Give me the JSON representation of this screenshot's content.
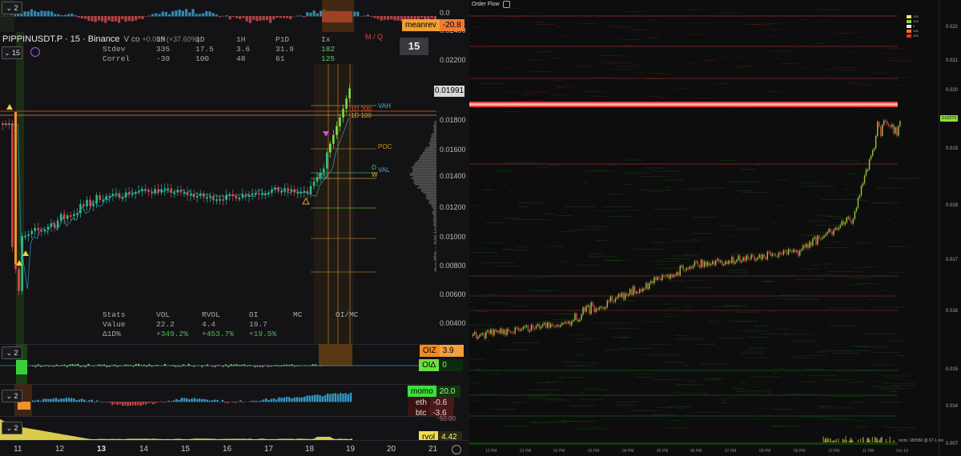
{
  "left_chart": {
    "symbol_title": "PIPPINUSDT.P · 15 · Binance",
    "title_suffix": "V co",
    "change_text": "+0.005 (+37.60%)",
    "interval_selector": "15",
    "pane_badge": "2",
    "header_cols": [
      "1M",
      "1D",
      "1H",
      "P1D",
      "Ix"
    ],
    "stdev_row": {
      "label": "Stdev",
      "values": [
        "335",
        "17.5",
        "3.6",
        "31.9",
        "182"
      ]
    },
    "correl_row": {
      "label": "Correl",
      "values": [
        "-39",
        "100",
        "48",
        "61",
        "125"
      ]
    },
    "meanrev": {
      "label": "meanrev",
      "value": "-20.8"
    },
    "mq_label": "M / Q",
    "interval_box": "15",
    "price_axis": [
      "0.0",
      "0.02400",
      "0.02200",
      "0.01800",
      "0.01600",
      "0.01400",
      "0.01200",
      "0.01000",
      "0.00800",
      "0.00600",
      "0.00400"
    ],
    "current_price": "0.01991",
    "level_labels": {
      "vah": "VAH",
      "poc": "POC",
      "val": "VAL",
      "d": "D",
      "w": "W",
      "ma200": "1D 200",
      "ma100": "1D 100",
      "n120": "120"
    },
    "bottom_stats": {
      "headers": [
        "Stats",
        "VOL",
        "RVOL",
        "OI",
        "MC",
        "OI/MC"
      ],
      "value_row": [
        "Value",
        "22.2",
        "4.4",
        "19.7"
      ],
      "delta_row": [
        "Δ1D%",
        "+349.2%",
        "+453.7%",
        "+19.5%"
      ]
    },
    "badges": {
      "oi_z": {
        "label": "OIZ",
        "value": "3.9"
      },
      "oi_delta": {
        "label": "OIΔ",
        "value": "0"
      },
      "momo": {
        "label": "momo",
        "value": "20.0"
      },
      "eth": {
        "label": "eth",
        "value": "-0.6"
      },
      "btc": {
        "label": "btc",
        "value": "-3.6"
      },
      "rvol": {
        "label": "rvol",
        "value": "4.42"
      }
    },
    "lower_axis_fragment": "50.00",
    "x_axis": [
      "11",
      "12",
      "13",
      "14",
      "15",
      "16",
      "17",
      "18",
      "19",
      "20",
      "21"
    ],
    "colors": {
      "up": "#2bbf8a",
      "down": "#e04848",
      "accent_orange": "#f0932b",
      "highlight_green": "#7ee84a"
    }
  },
  "right_chart": {
    "title": "Order Flow",
    "price_axis": [
      "0.022",
      "0.021",
      "0.020",
      "0.019",
      "0.018",
      "0.017",
      "0.016",
      "0.015",
      "0.014",
      "0.007"
    ],
    "current_price": "0.02273",
    "time_axis": [
      "12 PM",
      "01 PM",
      "02 PM",
      "03 PM",
      "04 PM",
      "05 PM",
      "06 PM",
      "07 PM",
      "08 PM",
      "09 PM",
      "10 PM",
      "11 PM",
      "Oct 19"
    ],
    "legend": [
      "20K",
      "10K",
      "0",
      "10K",
      "20K"
    ],
    "render_stats": "rects: 180580 @ 67.1 ms"
  }
}
